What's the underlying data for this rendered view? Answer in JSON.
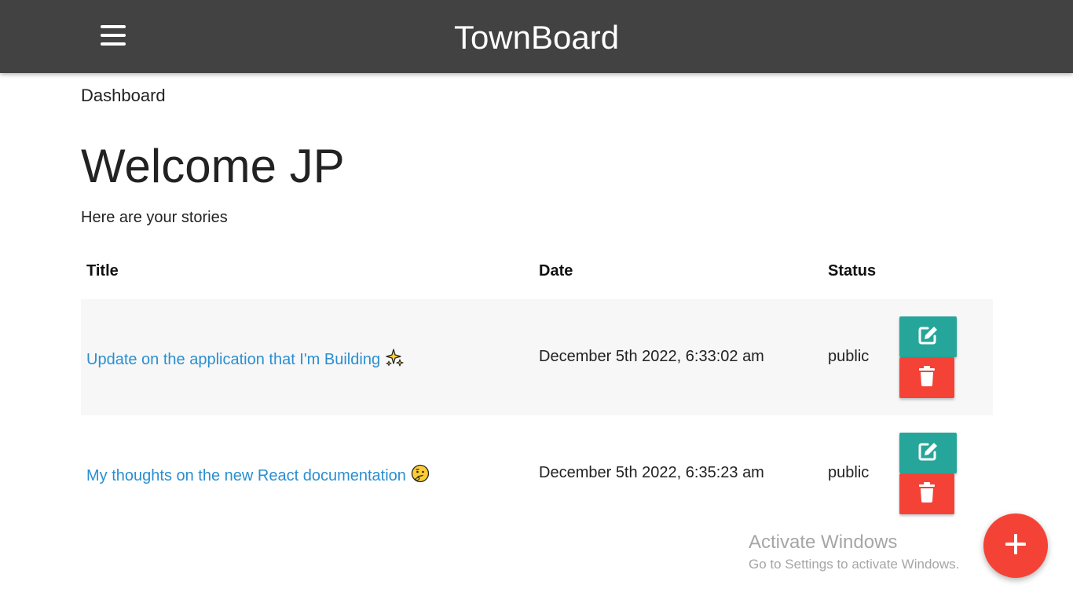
{
  "navbar": {
    "brand": "TownBoard",
    "menu_icon": "hamburger-menu-icon"
  },
  "page": {
    "breadcrumb": "Dashboard",
    "welcome": "Welcome JP",
    "subtitle": "Here are your stories"
  },
  "table": {
    "headers": {
      "title": "Title",
      "date": "Date",
      "status": "Status"
    },
    "rows": [
      {
        "title": "Update on the application that I'm Building",
        "emoji": "sparkles-icon",
        "date": "December 5th 2022, 6:33:02 am",
        "status": "public"
      },
      {
        "title": "My thoughts on the new React documentation",
        "emoji": "thinking-face-icon",
        "date": "December 5th 2022, 6:35:23 am",
        "status": "public"
      }
    ]
  },
  "actions": {
    "edit_icon": "edit-icon",
    "delete_icon": "trash-icon",
    "add_icon": "plus-icon"
  },
  "colors": {
    "navbar": "#424242",
    "link": "#2a8fd0",
    "edit": "#26a69a",
    "delete": "#f44336",
    "fab": "#f44336"
  },
  "watermark": {
    "title": "Activate Windows",
    "subtitle": "Go to Settings to activate Windows."
  }
}
